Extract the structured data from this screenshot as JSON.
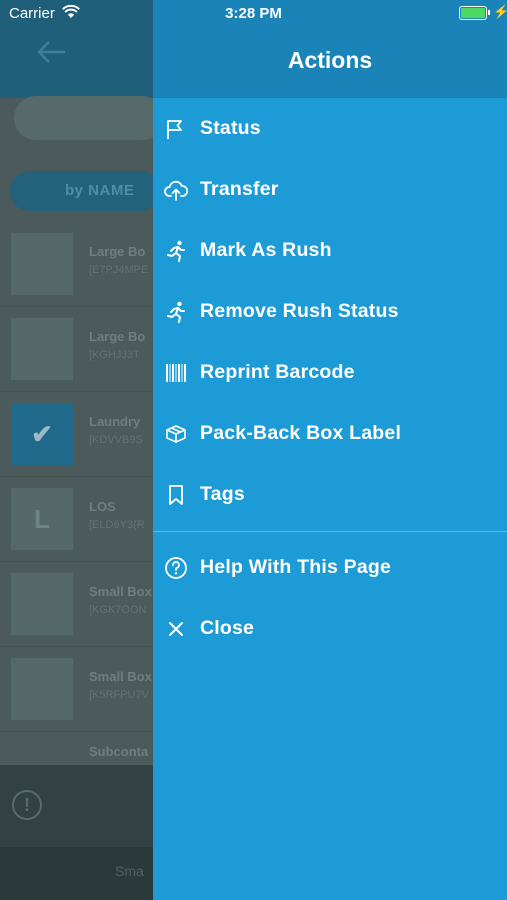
{
  "status_bar": {
    "carrier": "Carrier",
    "time": "3:28 PM"
  },
  "background": {
    "sort_label": "by NAME",
    "list": [
      {
        "title": "Large Bo",
        "sub": "[E7PJ4MPE",
        "thumb": ""
      },
      {
        "title": "Large Bo",
        "sub": "[KGHJJ3T",
        "thumb": ""
      },
      {
        "title": "Laundry",
        "sub": "[KDVVB9S",
        "thumb": "✔",
        "checked": true
      },
      {
        "title": "LOS",
        "sub": "[ELD6Y3(R",
        "thumb": "L"
      },
      {
        "title": "Small Box",
        "sub": "[KGK7OON",
        "thumb": ""
      },
      {
        "title": "Small Box",
        "sub": "[K5RFPU7V",
        "thumb": ""
      },
      {
        "title": "Subconta",
        "sub": "",
        "thumb": ""
      }
    ],
    "bottom_warn": "!",
    "footer_label": "Sma"
  },
  "drawer": {
    "title": "Actions",
    "items": [
      {
        "label": "Status",
        "icon": "flag-icon"
      },
      {
        "label": "Transfer",
        "icon": "cloud-upload-icon"
      },
      {
        "label": "Mark As Rush",
        "icon": "running-person-icon"
      },
      {
        "label": "Remove Rush Status",
        "icon": "running-person-icon"
      },
      {
        "label": "Reprint Barcode",
        "icon": "barcode-icon"
      },
      {
        "label": "Pack-Back Box Label",
        "icon": "box-icon"
      },
      {
        "label": "Tags",
        "icon": "bookmark-icon"
      }
    ],
    "secondary_items": [
      {
        "label": "Help With This Page",
        "icon": "help-circle-icon"
      },
      {
        "label": "Close",
        "icon": "close-icon"
      }
    ]
  },
  "colors": {
    "drawer_bg": "#1d9bd6",
    "drawer_header": "#1a84b9",
    "battery_green": "#4cd964"
  }
}
